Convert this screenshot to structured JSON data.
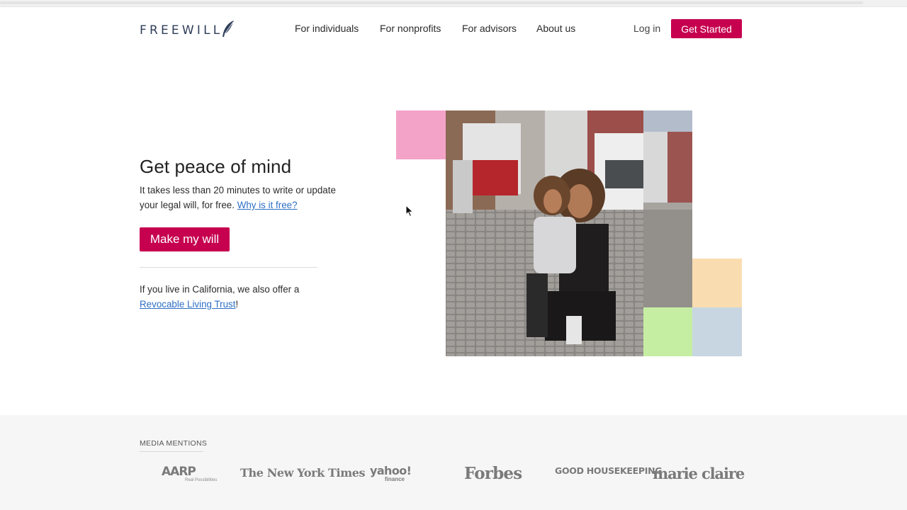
{
  "header": {
    "logo_text": "FREEWILL",
    "nav": [
      {
        "label": "For individuals"
      },
      {
        "label": "For nonprofits"
      },
      {
        "label": "For advisors"
      },
      {
        "label": "About us"
      }
    ],
    "login_label": "Log in",
    "cta_label": "Get Started"
  },
  "hero": {
    "title": "Get peace of mind",
    "text": "It takes less than 20 minutes to write or update your legal will, for free.",
    "link": "Why is it free?",
    "button_label": "Make my will",
    "ca_text": "If you live in California, we also offer a",
    "ca_link": "Revocable Living Trust",
    "ca_suffix": "!"
  },
  "media": {
    "label": "MEDIA MENTIONS",
    "logos": {
      "aarp": "AARP",
      "aarp_sub": "Real Possibilities",
      "nyt": "The New York Times",
      "yahoo": "yahoo!",
      "yahoo_sub": "finance",
      "forbes": "Forbes",
      "gh": "GOOD HOUSEKEEPING",
      "mc": "marie claire"
    }
  },
  "colors": {
    "brand": "#c6004f",
    "link": "#2d6fc4",
    "square_pink": "#f4a3c8",
    "square_peach": "#f9ddb0",
    "square_green": "#c6eea3",
    "square_blue": "#c8d6e2"
  },
  "icons": [
    "quill-icon",
    "cursor-icon"
  ]
}
